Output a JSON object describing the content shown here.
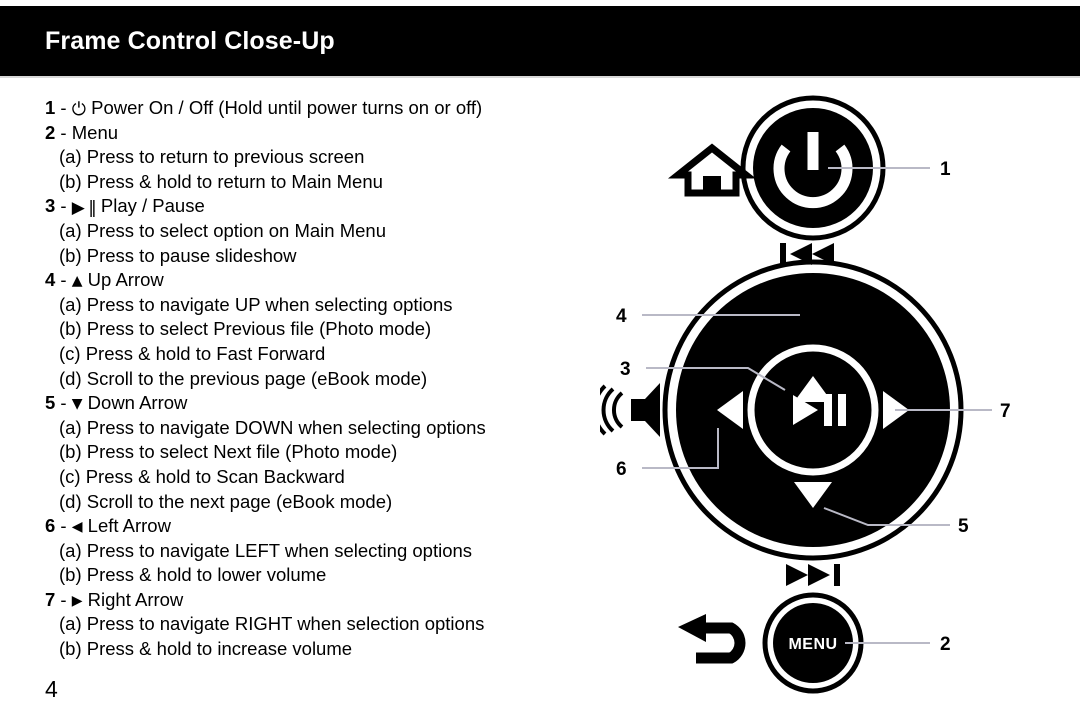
{
  "header": {
    "title": "Frame Control Close-Up"
  },
  "page_number": "4",
  "instructions": [
    {
      "level": 0,
      "num": "1",
      "dash": " - ",
      "icon": "power-icon",
      "glyph": "⏻",
      "text": " Power On / Off (Hold until power turns on or off)"
    },
    {
      "level": 0,
      "num": "2",
      "dash": " - ",
      "icon": null,
      "glyph": "",
      "text": "Menu"
    },
    {
      "level": 1,
      "num": "",
      "dash": "",
      "icon": null,
      "glyph": "",
      "text": "(a) Press to return to previous screen"
    },
    {
      "level": 1,
      "num": "",
      "dash": "",
      "icon": null,
      "glyph": "",
      "text": "(b) Press & hold to return to Main Menu"
    },
    {
      "level": 0,
      "num": "3",
      "dash": " - ",
      "icon": "play-pause-icon",
      "glyph": "▶ ‖",
      "text": " Play / Pause"
    },
    {
      "level": 1,
      "num": "",
      "dash": "",
      "icon": null,
      "glyph": "",
      "text": "(a) Press to select option on Main Menu"
    },
    {
      "level": 1,
      "num": "",
      "dash": "",
      "icon": null,
      "glyph": "",
      "text": "(b) Press to pause slideshow"
    },
    {
      "level": 0,
      "num": "4",
      "dash": " - ",
      "icon": "up-arrow-icon",
      "glyph": "▲",
      "text": " Up Arrow"
    },
    {
      "level": 1,
      "num": "",
      "dash": "",
      "icon": null,
      "glyph": "",
      "text": "(a) Press to navigate UP when selecting options"
    },
    {
      "level": 1,
      "num": "",
      "dash": "",
      "icon": null,
      "glyph": "",
      "text": "(b) Press to select Previous file (Photo mode)"
    },
    {
      "level": 1,
      "num": "",
      "dash": "",
      "icon": null,
      "glyph": "",
      "text": "(c) Press & hold to Fast Forward"
    },
    {
      "level": 1,
      "num": "",
      "dash": "",
      "icon": null,
      "glyph": "",
      "text": "(d) Scroll to the previous page (eBook mode)"
    },
    {
      "level": 0,
      "num": "5",
      "dash": " - ",
      "icon": "down-arrow-icon",
      "glyph": "▼",
      "text": " Down Arrow"
    },
    {
      "level": 1,
      "num": "",
      "dash": "",
      "icon": null,
      "glyph": "",
      "text": "(a) Press to navigate DOWN when selecting options"
    },
    {
      "level": 1,
      "num": "",
      "dash": "",
      "icon": null,
      "glyph": "",
      "text": "(b) Press to select Next file (Photo mode)"
    },
    {
      "level": 1,
      "num": "",
      "dash": "",
      "icon": null,
      "glyph": "",
      "text": "(c) Press & hold to Scan Backward"
    },
    {
      "level": 1,
      "num": "",
      "dash": "",
      "icon": null,
      "glyph": "",
      "text": "(d) Scroll to the next page (eBook mode)"
    },
    {
      "level": 0,
      "num": "6",
      "dash": " - ",
      "icon": "left-arrow-icon",
      "glyph": "◀",
      "text": " Left Arrow"
    },
    {
      "level": 1,
      "num": "",
      "dash": "",
      "icon": null,
      "glyph": "",
      "text": "(a) Press to navigate LEFT when selecting options"
    },
    {
      "level": 1,
      "num": "",
      "dash": "",
      "icon": null,
      "glyph": "",
      "text": "(b) Press & hold to lower volume"
    },
    {
      "level": 0,
      "num": "7",
      "dash": " - ",
      "icon": "right-arrow-icon",
      "glyph": "▶",
      "text": " Right Arrow"
    },
    {
      "level": 1,
      "num": "",
      "dash": "",
      "icon": null,
      "glyph": "",
      "text": "(a) Press to navigate RIGHT when selection options"
    },
    {
      "level": 1,
      "num": "",
      "dash": "",
      "icon": null,
      "glyph": "",
      "text": "(b) Press & hold to increase volume"
    }
  ],
  "diagram": {
    "power_button": {
      "name": "power-button",
      "callout": "1"
    },
    "menu_button": {
      "name": "menu-button",
      "label": "MENU",
      "callout": "2"
    },
    "play_pause_button": {
      "name": "play-pause-button",
      "callout": "3"
    },
    "up_arrow_button": {
      "name": "up-arrow-button",
      "callout": "4"
    },
    "down_arrow_button": {
      "name": "down-arrow-button",
      "callout": "5"
    },
    "left_arrow_button": {
      "name": "left-arrow-button",
      "callout": "6"
    },
    "right_arrow_button": {
      "name": "right-arrow-button",
      "callout": "7"
    },
    "side_icons": {
      "home": "home-icon",
      "previous_track": "previous-track-icon",
      "volume": "volume-speaker-icon",
      "next_track": "next-track-icon",
      "back": "back-arrow-icon"
    },
    "colors": {
      "button_fill": "#000000",
      "icon_white": "#ffffff",
      "leader_line": "#b9b9c6",
      "header_bg": "#000000",
      "header_text": "#ffffff"
    }
  }
}
